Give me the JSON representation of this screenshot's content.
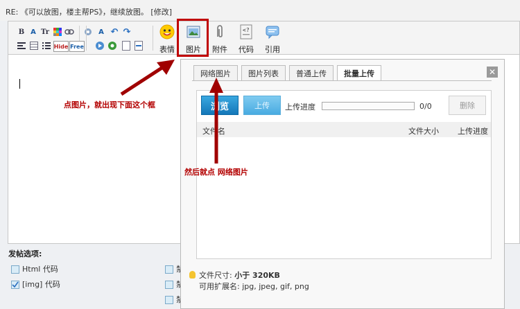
{
  "title": "RE: 《可以放图，楼主帮PS》，继续放图。 [修改]",
  "toolbar": {
    "buttons": [
      {
        "label": "表情",
        "icon": "smiley-icon"
      },
      {
        "label": "图片",
        "icon": "image-icon"
      },
      {
        "label": "附件",
        "icon": "paperclip-icon"
      },
      {
        "label": "代码",
        "icon": "code-icon"
      },
      {
        "label": "引用",
        "icon": "quote-icon"
      }
    ],
    "small_icons_row1": [
      "bold-icon",
      "font-color-icon",
      "font-size-icon",
      "color-grid-icon",
      "link-icon",
      "unlink-icon",
      "spellcheck-icon",
      "undo-icon",
      "redo-icon"
    ],
    "small_icons_row2": [
      "align-icon",
      "table-icon",
      "list-icon",
      "hide-icon",
      "free-icon",
      "media-icon",
      "flash-icon",
      "page-icon",
      "page-break-icon"
    ],
    "hide_label": "Hide",
    "free_label": "Free"
  },
  "annotations": {
    "click_image": "点图片，就出现下面这个框",
    "click_network": "然后就点 网络图片"
  },
  "dialog": {
    "tabs": [
      "网络图片",
      "图片列表",
      "普通上传",
      "批量上传"
    ],
    "active_tab": 3,
    "close": "✕",
    "browse": "浏览",
    "upload": "上传",
    "progress_label": "上传进度",
    "progress_value": 0,
    "progress_count": "0/0",
    "delete": "删除",
    "columns": [
      "文件名",
      "文件大小",
      "上传进度"
    ],
    "size_label": "文件尺寸:",
    "size_value": "小于 320KB",
    "ext_label": "可用扩展名:",
    "ext_value": "jpg, jpeg, gif, png"
  },
  "options": {
    "title": "发帖选项:",
    "items": [
      {
        "label": "Html 代码",
        "checked": false
      },
      {
        "label": "[img] 代码",
        "checked": true
      }
    ],
    "right_items": [
      "禁",
      "禁",
      "禁"
    ]
  },
  "colors": {
    "accent": "#1477b9",
    "annotation": "#b30000"
  }
}
